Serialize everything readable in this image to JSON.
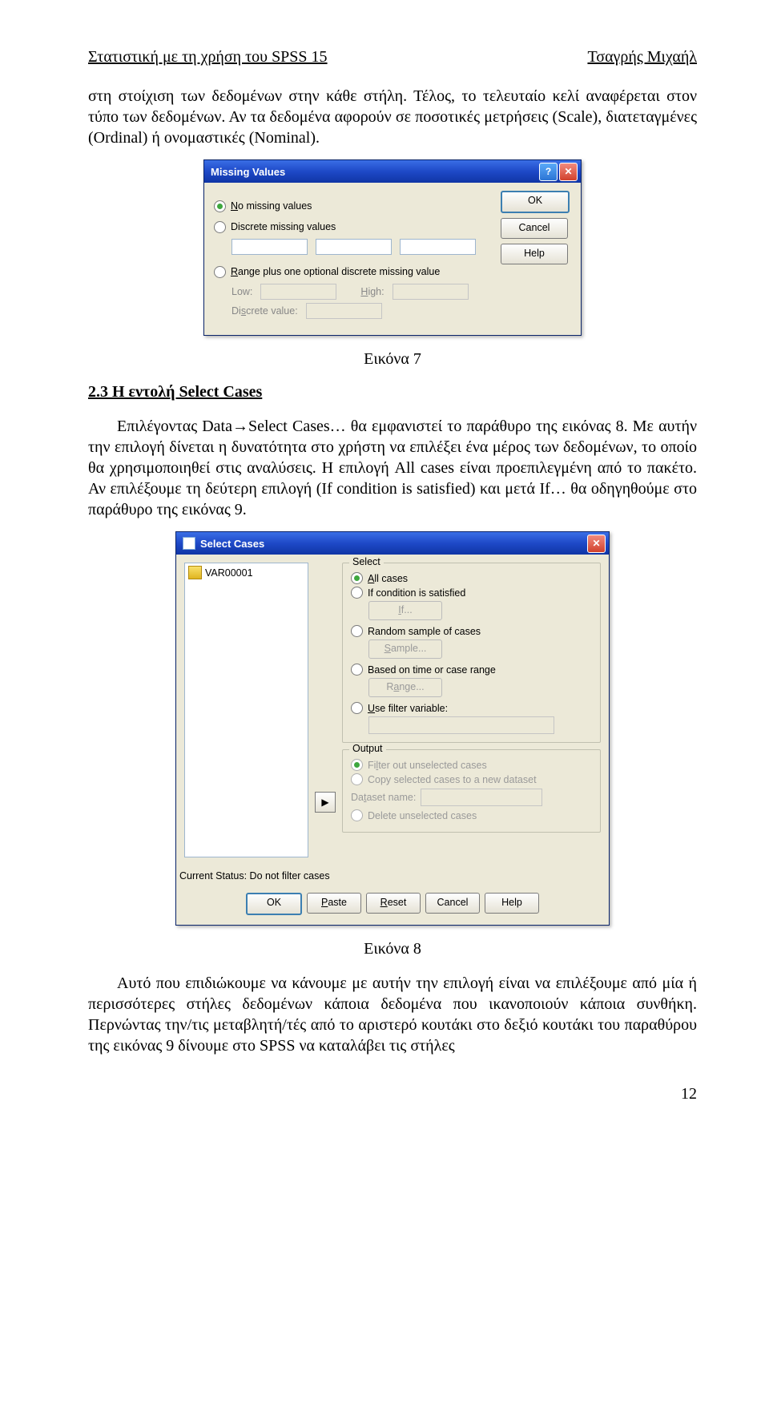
{
  "header": {
    "left": "Στατιστική με τη χρήση του  SPSS 15",
    "right": "Τσαγρής Μιχαήλ"
  },
  "para1": "στη στοίχιση των δεδομένων στην κάθε στήλη. Τέλος, το τελευταίο κελί αναφέρεται στον τύπο των δεδομένων. Αν τα δεδομένα αφορούν σε ποσοτικές μετρήσεις (Scale), διατεταγμένες (Ordinal) ή ονομαστικές (Nominal).",
  "captions": {
    "fig7": "Εικόνα 7",
    "fig8": "Εικόνα 8"
  },
  "section_heading": "2.3 Η εντολή Select Cases",
  "para2": "Επιλέγοντας Data→Select Cases… θα εμφανιστεί το παράθυρο της εικόνας 8. Με αυτήν την επιλογή δίνεται η δυνατότητα στο χρήστη να επιλέξει ένα μέρος των δεδομένων, το οποίο θα χρησιμοποιηθεί στις αναλύσεις. Η επιλογή All cases είναι προεπιλεγμένη από το πακέτο. Αν επιλέξουμε τη δεύτερη επιλογή (If condition is satisfied) και μετά If… θα οδηγηθούμε στο παράθυρο της εικόνας 9.",
  "para3": "Αυτό που επιδιώκουμε να κάνουμε με αυτήν την επιλογή είναι να επιλέξουμε από μία ή περισσότερες στήλες δεδομένων κάποια δεδομένα που ικανοποιούν κάποια συνθήκη. Περνώντας την/τις μεταβλητή/τές από το αριστερό κουτάκι στο δεξιό κουτάκι του παραθύρου της εικόνας 9 δίνουμε στο SPSS να καταλάβει τις στήλες",
  "page_number": "12",
  "missing_values": {
    "title": "Missing Values",
    "opt_no": "No missing values",
    "opt_discrete": "Discrete missing values",
    "opt_range": "Range plus one optional discrete missing value",
    "low": "Low:",
    "high": "High:",
    "discrete_value": "Discrete value:",
    "btn_ok": "OK",
    "btn_cancel": "Cancel",
    "btn_help": "Help"
  },
  "select_cases": {
    "title": "Select Cases",
    "var_item": "VAR00001",
    "grp_select": "Select",
    "opt_all": "All cases",
    "opt_if": "If condition is satisfied",
    "btn_if": "If...",
    "opt_random": "Random sample of cases",
    "btn_sample": "Sample...",
    "opt_range": "Based on time or case range",
    "btn_range": "Range...",
    "opt_usefilter": "Use filter variable:",
    "grp_output": "Output",
    "out_filter": "Filter out unselected cases",
    "out_copy": "Copy selected cases to a new dataset",
    "ds_label": "Dataset name:",
    "out_delete": "Delete unselected cases",
    "status": "Current Status: Do not filter cases",
    "btn_ok": "OK",
    "btn_paste": "Paste",
    "btn_reset": "Reset",
    "btn_cancel": "Cancel",
    "btn_help": "Help"
  }
}
